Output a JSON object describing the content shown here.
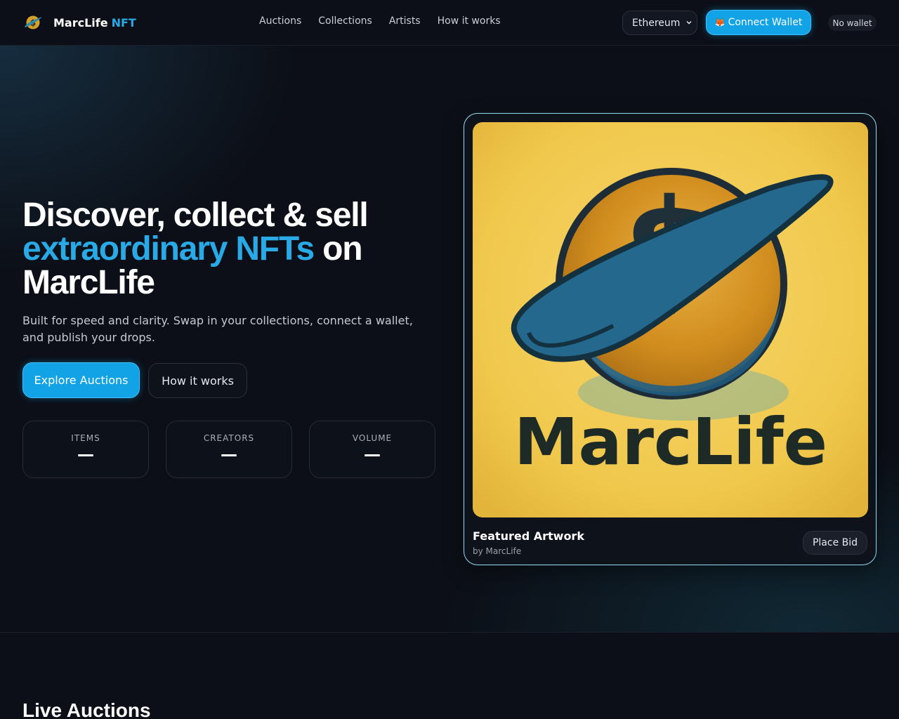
{
  "header": {
    "brand_name": "MarcLife",
    "brand_accent": "NFT",
    "nav": [
      "Auctions",
      "Collections",
      "Artists",
      "How it works"
    ],
    "chain_selected": "Ethereum",
    "connect_label": "Connect Wallet",
    "connect_icon": "fox-icon",
    "wallet_status": "No wallet"
  },
  "hero": {
    "title_line1": "Discover, collect & sell",
    "title_highlight": "extraordinary NFTs",
    "title_on": " on",
    "title_line3": "MarcLife",
    "subtitle": "Built for speed and clarity. Swap in your collections, connect a wallet, and publish your drops.",
    "primary_button": "Explore Auctions",
    "secondary_button": "How it works",
    "stats": [
      {
        "label": "ITEMS",
        "value": "—"
      },
      {
        "label": "CREATORS",
        "value": "—"
      },
      {
        "label": "VOLUME",
        "value": "—"
      }
    ]
  },
  "featured": {
    "title": "Featured Artwork",
    "by": "by MarcLife",
    "bid_button": "Place Bid",
    "art_text": "MarcLife"
  },
  "live_auctions_title": "Live Auctions",
  "colors": {
    "accent": "#29a9e6",
    "button": "#12a3e6",
    "background": "#0c0f17"
  }
}
